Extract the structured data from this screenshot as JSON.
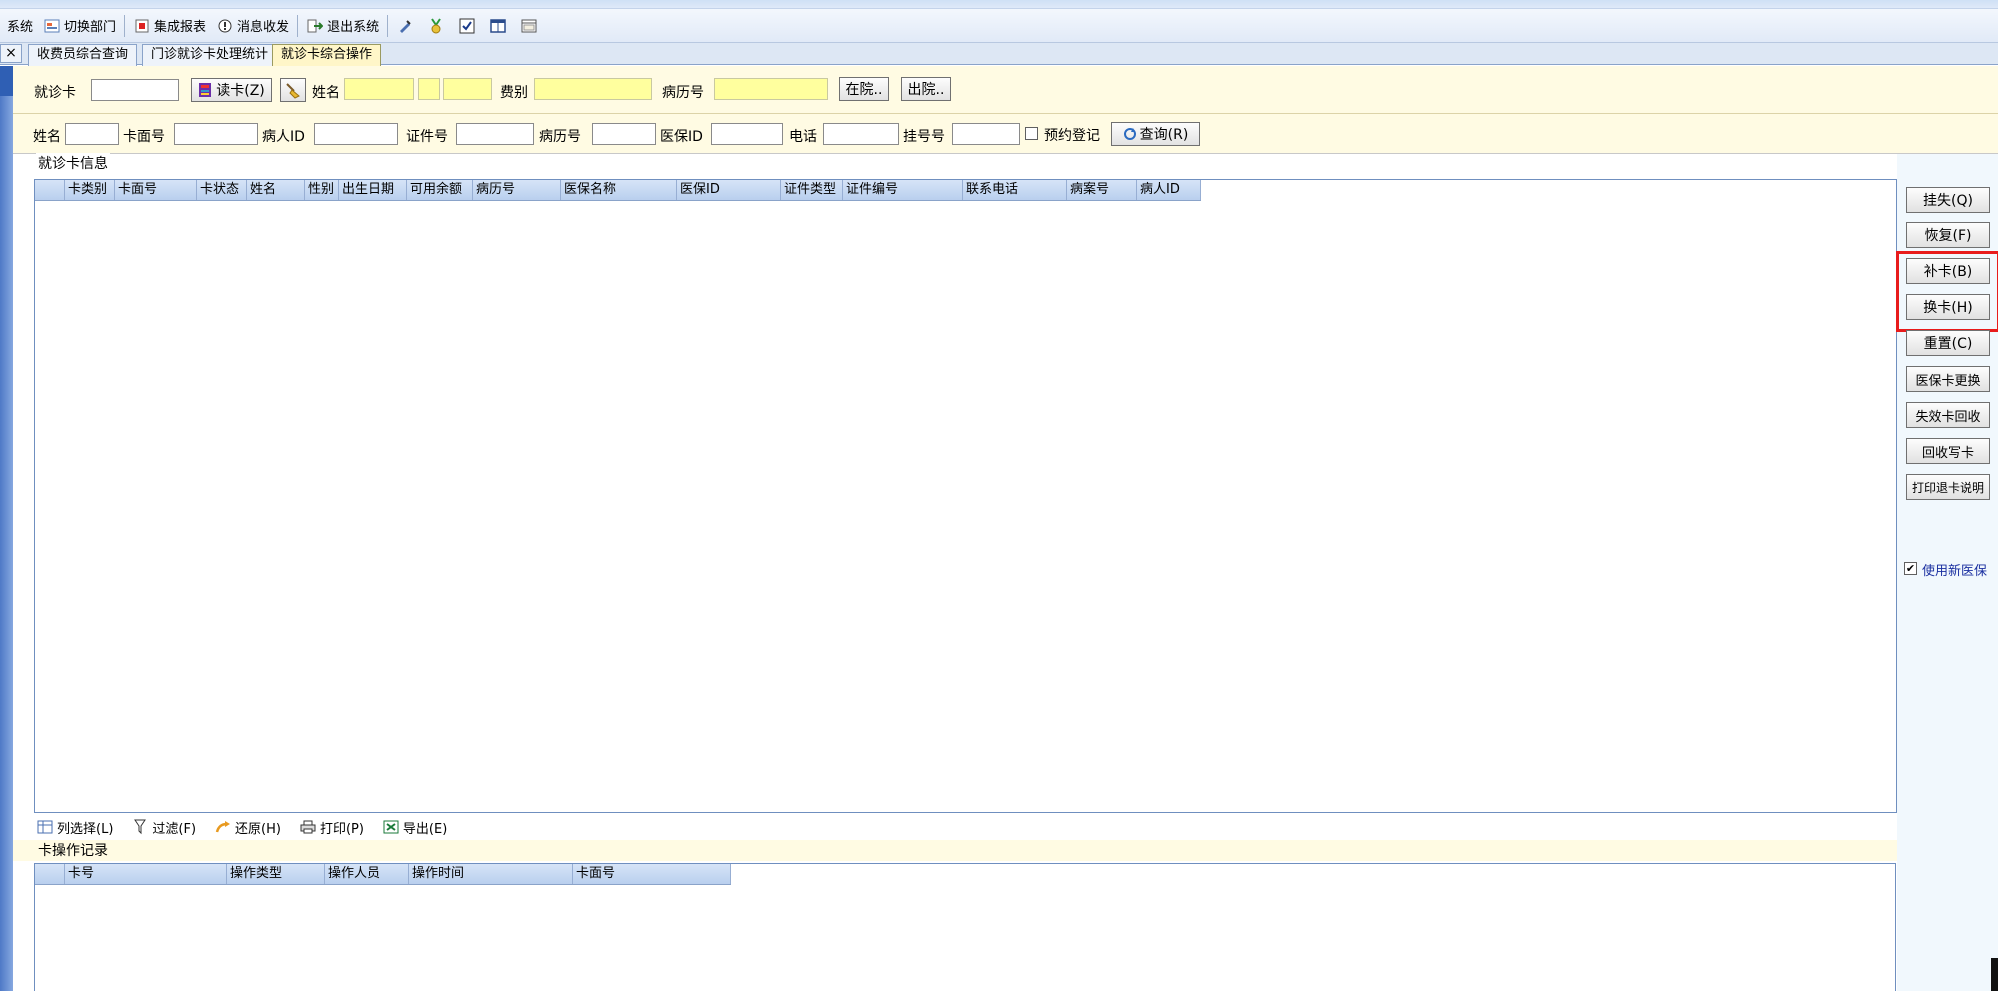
{
  "toolbar": {
    "items": [
      {
        "label": "系统",
        "icon": "system-icon"
      },
      {
        "label": "切换部门",
        "icon": "switch-dept-icon"
      },
      {
        "label": "集成报表",
        "icon": "report-icon"
      },
      {
        "label": "消息收发",
        "icon": "message-icon"
      },
      {
        "label": "退出系统",
        "icon": "exit-icon"
      }
    ],
    "extra_icons": [
      "edit-icon",
      "medal-icon",
      "checkbox-icon",
      "layout-icon",
      "window-icon"
    ]
  },
  "tabs": [
    {
      "label": "收费员综合查询",
      "active": false
    },
    {
      "label": "门诊就诊卡处理统计",
      "active": false
    },
    {
      "label": "就诊卡综合操作",
      "active": true
    }
  ],
  "tab_close": "×",
  "row1": {
    "card_label": "就诊卡",
    "card_value": "",
    "read_card_button": "读卡(Z)",
    "name_label": "姓名",
    "fee_type_label": "费别",
    "record_no_label": "病历号",
    "inpatient_button": "在院..",
    "discharge_button": "出院.."
  },
  "row2": {
    "name_label": "姓名",
    "card_face_label": "卡面号",
    "patient_id_label": "病人ID",
    "cert_label": "证件号",
    "record_label": "病历号",
    "insurance_id_label": "医保ID",
    "phone_label": "电话",
    "reg_label": "挂号号",
    "appointment_label": "预约登记",
    "query_button": "查询(R)"
  },
  "card_info": {
    "title": "就诊卡信息",
    "columns": [
      "卡类别",
      "卡面号",
      "卡状态",
      "姓名",
      "性别",
      "出生日期",
      "可用余额",
      "病历号",
      "医保名称",
      "医保ID",
      "证件类型",
      "证件编号",
      "联系电话",
      "病案号",
      "病人ID"
    ]
  },
  "grid_toolbar": [
    {
      "label": "列选择(L)",
      "icon": "column-select-icon"
    },
    {
      "label": "过滤(F)",
      "icon": "filter-icon"
    },
    {
      "label": "还原(H)",
      "icon": "restore-icon"
    },
    {
      "label": "打印(P)",
      "icon": "print-icon"
    },
    {
      "label": "导出(E)",
      "icon": "export-icon"
    }
  ],
  "op_records": {
    "title": "卡操作记录",
    "columns": [
      "卡号",
      "操作类型",
      "操作人员",
      "操作时间",
      "卡面号"
    ]
  },
  "side_buttons": [
    "挂失(Q)",
    "恢复(F)",
    "补卡(B)",
    "换卡(H)",
    "重置(C)",
    "医保卡更换",
    "失效卡回收",
    "回收写卡",
    "打印退卡说明"
  ],
  "new_insurance_label": "使用新医保",
  "new_insurance_checked": true
}
